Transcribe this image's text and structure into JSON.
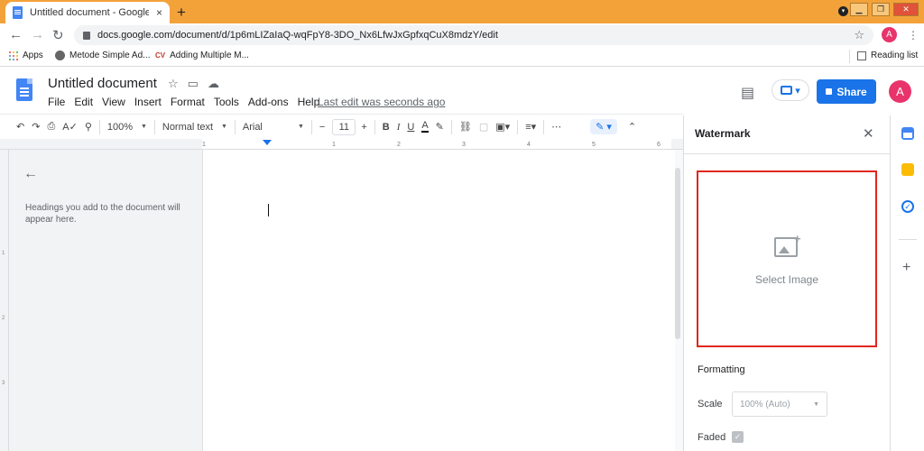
{
  "browser": {
    "tab_title": "Untitled document - Google Docs",
    "tab_close": "×",
    "new_tab": "+",
    "url": "docs.google.com/document/d/1p6mLIZaIaQ-wqFpY8-3DO_Nx6LfwJxGpfxqCuX8mdzY/edit",
    "profile_initial": "A",
    "window_controls": [
      "▁",
      "❐",
      "✕"
    ],
    "bookmarks": [
      {
        "label": "Apps",
        "icon": "apps-grid-icon"
      },
      {
        "label": "Metode Simple Ad...",
        "icon": "globe-icon"
      },
      {
        "label": "Adding Multiple M...",
        "icon": "cv-icon"
      }
    ],
    "reading_list": "Reading list"
  },
  "docs": {
    "title": "Untitled document",
    "menu": [
      "File",
      "Edit",
      "View",
      "Insert",
      "Format",
      "Tools",
      "Add-ons",
      "Help"
    ],
    "last_edit": "Last edit was seconds ago",
    "share_label": "Share",
    "avatar_initial": "A"
  },
  "toolbar": {
    "zoom": "100%",
    "style": "Normal text",
    "font": "Arial",
    "font_size": "11",
    "minus": "−",
    "plus": "+",
    "bold": "B",
    "italic": "I",
    "underline": "U",
    "text_color": "A",
    "more": "⋯"
  },
  "ruler": {
    "ticks": [
      "1",
      "1",
      "2",
      "3",
      "4",
      "5",
      "6"
    ]
  },
  "outline": {
    "placeholder": "Headings you add to the document will appear here."
  },
  "watermark": {
    "title": "Watermark",
    "select_image": "Select Image",
    "formatting": "Formatting",
    "scale_label": "Scale",
    "scale_value": "100% (Auto)",
    "faded_label": "Faded",
    "faded_checked": true,
    "highlight_color": "#e1261c"
  },
  "colors": {
    "chrome_frame": "#f3a23a",
    "accent": "#1a73e8",
    "avatar": "#e8336b"
  }
}
